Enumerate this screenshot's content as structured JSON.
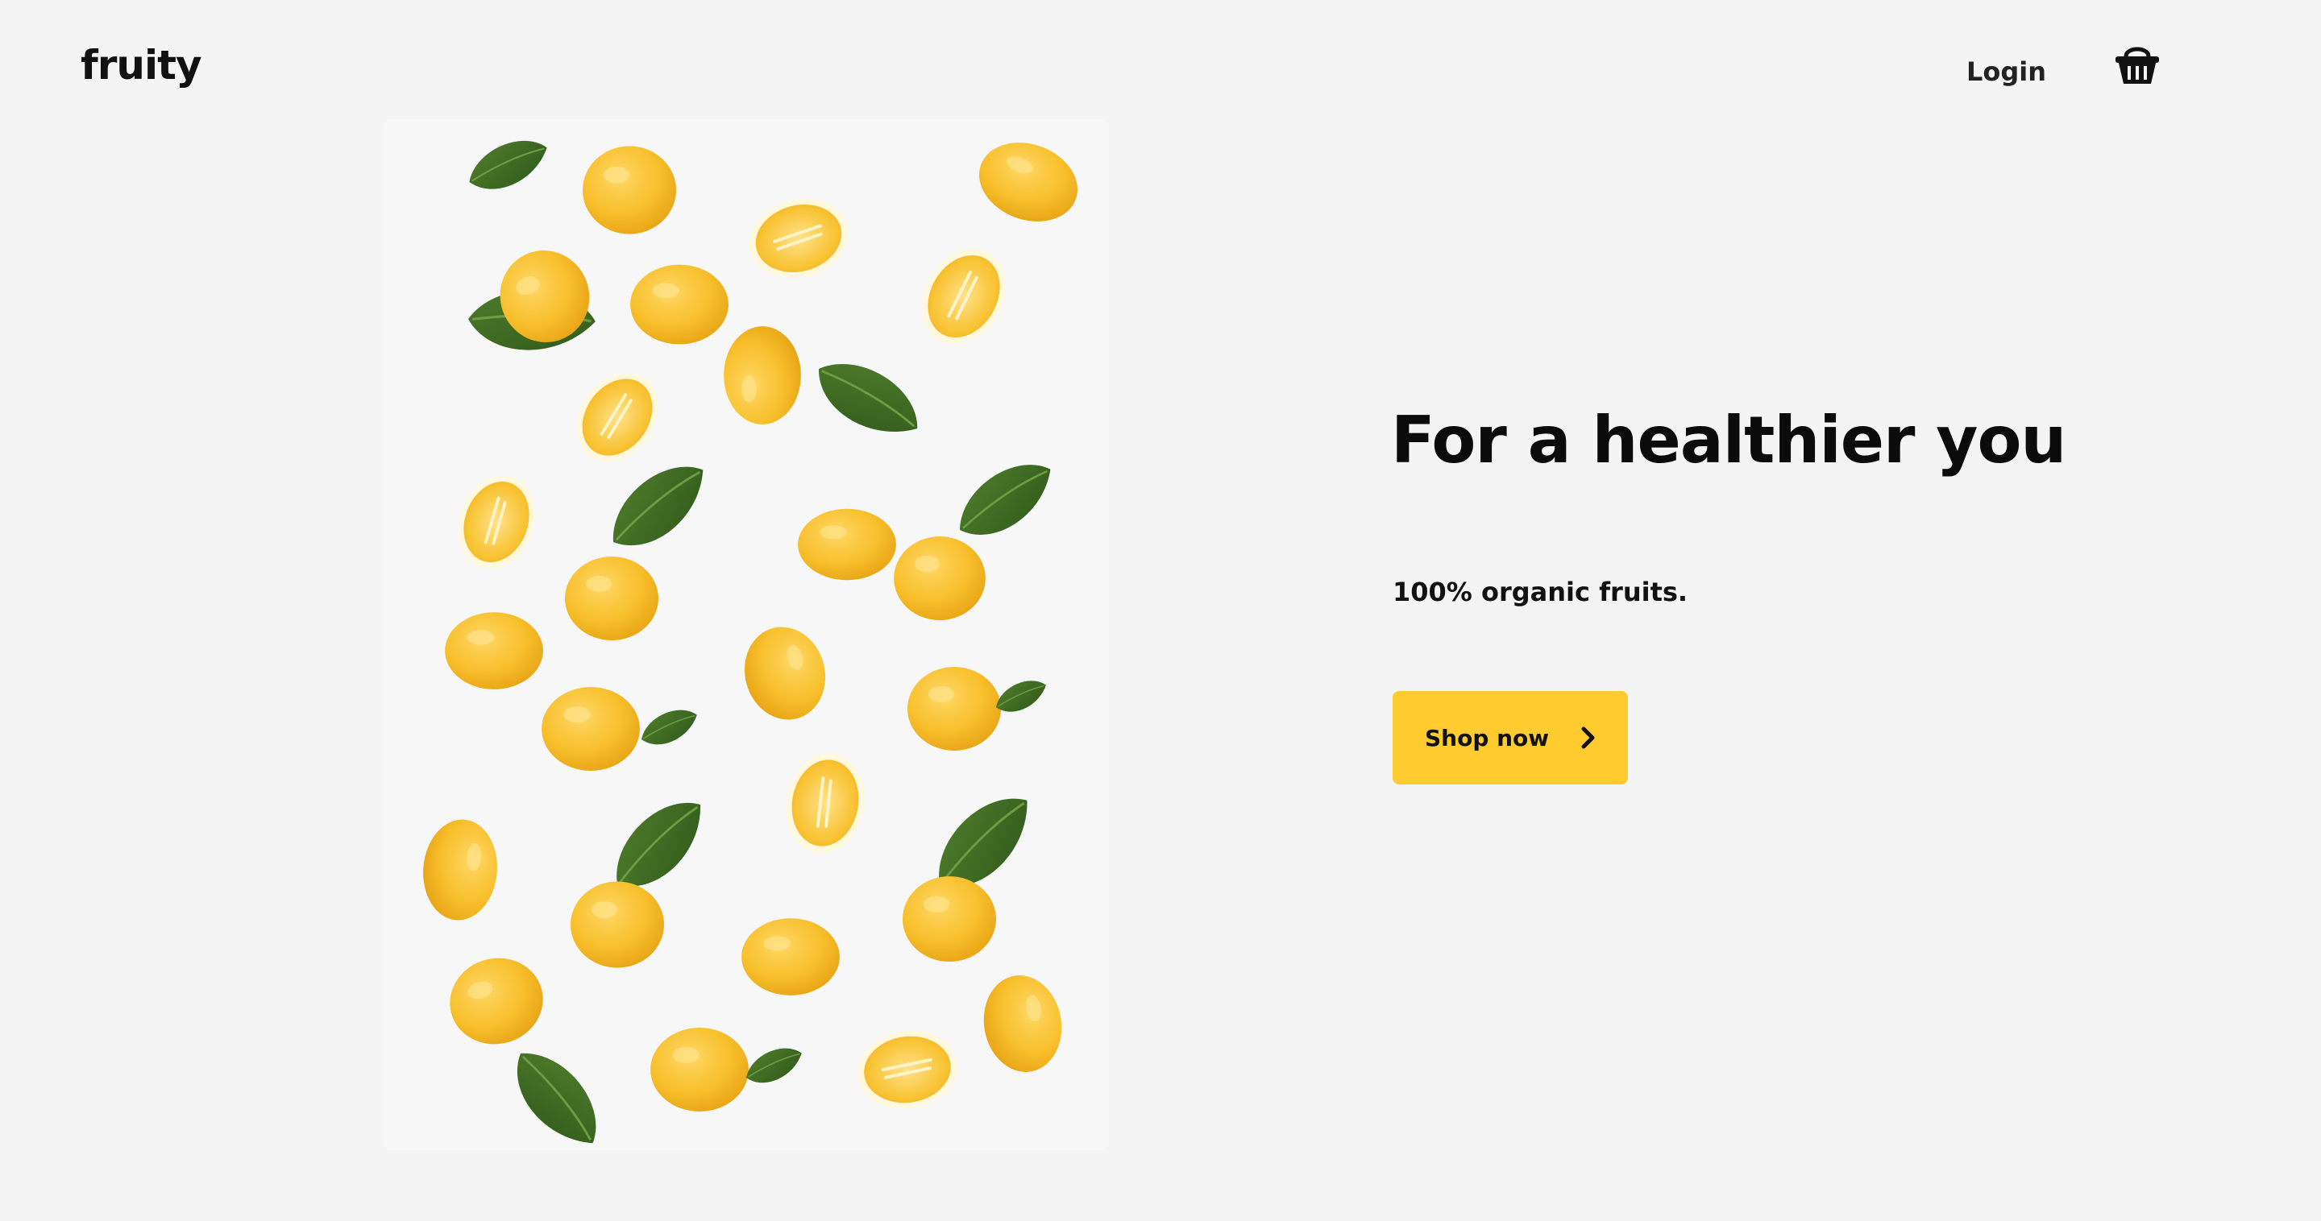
{
  "brand": {
    "name": "fruity"
  },
  "nav": {
    "login_label": "Login",
    "cart_icon": "basket-icon"
  },
  "hero": {
    "headline": "For a healthier you",
    "subline": "100% organic fruits.",
    "cta_label": "Shop now",
    "cta_icon": "chevron-right-icon",
    "image_alt": "lemons-and-leaves-image"
  },
  "colors": {
    "background": "#f4f4f4",
    "accent": "#ffcb2f",
    "text": "#111111"
  }
}
